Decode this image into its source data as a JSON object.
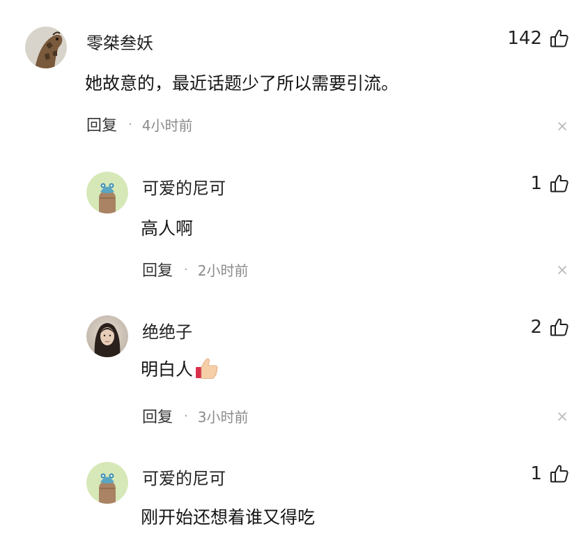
{
  "comments": [
    {
      "username": "零桀叁妖",
      "text": "她故意的，最近话题少了所以需要引流。",
      "likes": "142",
      "reply_label": "回复",
      "separator": "·",
      "time": "4小时前",
      "avatar_icon": "giraffe-avatar"
    },
    {
      "username": "可爱的尼可",
      "text": "高人啊",
      "likes": "1",
      "reply_label": "回复",
      "separator": "·",
      "time": "2小时前",
      "avatar_icon": "cartoon-avatar"
    },
    {
      "username": "绝绝子",
      "text": "明白人",
      "likes": "2",
      "reply_label": "回复",
      "separator": "·",
      "time": "3小时前",
      "avatar_icon": "portrait-avatar",
      "emoji_icon": "thumbs-up-emoji"
    },
    {
      "username": "可爱的尼可",
      "text": "刚开始还想着谁又得吃",
      "likes": "1",
      "avatar_icon": "cartoon-avatar"
    }
  ]
}
